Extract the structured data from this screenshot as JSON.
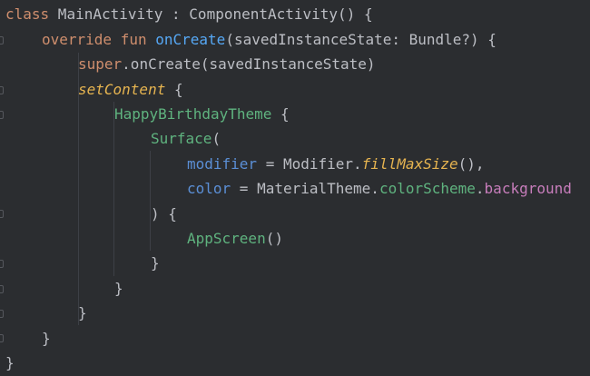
{
  "editor": {
    "lines": [
      {
        "tokens": [
          {
            "text": "class",
            "kind": "kw"
          },
          {
            "text": " MainActivity : ComponentActivity() {",
            "kind": "plain"
          }
        ]
      },
      {
        "tokens": [
          {
            "text": "override",
            "kind": "kw"
          },
          {
            "text": " ",
            "kind": "plain"
          },
          {
            "text": "fun",
            "kind": "kw"
          },
          {
            "text": " ",
            "kind": "plain"
          },
          {
            "text": "onCreate",
            "kind": "fn"
          },
          {
            "text": "(savedInstanceState: Bundle?) {",
            "kind": "plain"
          }
        ]
      },
      {
        "tokens": [
          {
            "text": "super",
            "kind": "kw"
          },
          {
            "text": ".onCreate(savedInstanceState)",
            "kind": "plain"
          }
        ]
      },
      {
        "tokens": [
          {
            "text": "setContent",
            "kind": "ext"
          },
          {
            "text": " {",
            "kind": "plain"
          }
        ]
      },
      {
        "tokens": [
          {
            "text": "HappyBirthdayTheme",
            "kind": "comp"
          },
          {
            "text": " {",
            "kind": "plain"
          }
        ]
      },
      {
        "tokens": [
          {
            "text": "Surface",
            "kind": "comp"
          },
          {
            "text": "(",
            "kind": "plain"
          }
        ]
      },
      {
        "tokens": [
          {
            "text": "modifier",
            "kind": "param"
          },
          {
            "text": " = Modifier.",
            "kind": "plain"
          },
          {
            "text": "fillMaxSize",
            "kind": "ext"
          },
          {
            "text": "(),",
            "kind": "plain"
          }
        ]
      },
      {
        "tokens": [
          {
            "text": "color",
            "kind": "param"
          },
          {
            "text": " = MaterialTheme.",
            "kind": "plain"
          },
          {
            "text": "colorScheme",
            "kind": "comp"
          },
          {
            "text": ".",
            "kind": "plain"
          },
          {
            "text": "background",
            "kind": "prop"
          }
        ]
      },
      {
        "tokens": [
          {
            "text": ") {",
            "kind": "plain"
          }
        ]
      },
      {
        "tokens": [
          {
            "text": "AppScreen",
            "kind": "comp"
          },
          {
            "text": "()",
            "kind": "plain"
          }
        ]
      },
      {
        "tokens": [
          {
            "text": "}",
            "kind": "plain"
          }
        ]
      },
      {
        "tokens": [
          {
            "text": "}",
            "kind": "plain"
          }
        ]
      },
      {
        "tokens": [
          {
            "text": "}",
            "kind": "plain"
          }
        ]
      },
      {
        "tokens": [
          {
            "text": "}",
            "kind": "plain"
          }
        ]
      },
      {
        "tokens": [
          {
            "text": "}",
            "kind": "plain"
          }
        ]
      }
    ]
  },
  "colors": {
    "background": "#2b2d30",
    "keyword": "#cf8e6d",
    "function": "#56a8f5",
    "composable": "#5fb37f",
    "parameter": "#5b8fd6",
    "property": "#c77dbb",
    "extension": "#e6b450",
    "text": "#bcbec4"
  }
}
